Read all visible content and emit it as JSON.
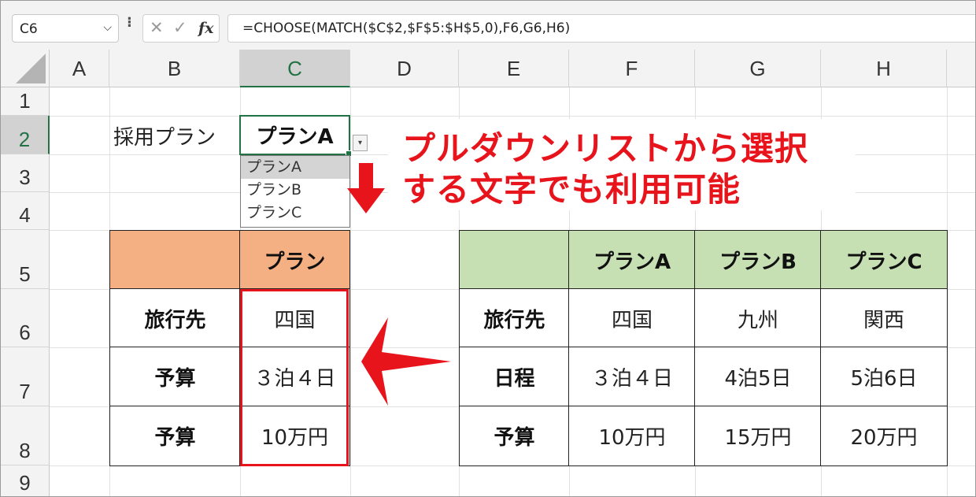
{
  "formula_bar": {
    "name_box": "C6",
    "cancel_glyph": "✕",
    "enter_glyph": "✓",
    "fx_label": "fx",
    "formula": "=CHOOSE(MATCH($C$2,$F$5:$H$5,0),F6,G6,H6)"
  },
  "columns": [
    "A",
    "B",
    "C",
    "D",
    "E",
    "F",
    "G",
    "H"
  ],
  "rows": [
    "1",
    "2",
    "3",
    "4",
    "5",
    "6",
    "7",
    "8",
    "9"
  ],
  "selected_column": "C",
  "selected_row": "2",
  "cells": {
    "B2": "採用プラン",
    "C2": "プランA"
  },
  "dropdown": {
    "options": [
      "プランA",
      "プランB",
      "プランC"
    ],
    "highlighted": "プランA"
  },
  "left_table": {
    "header": [
      "",
      "プラン"
    ],
    "rows": [
      [
        "旅行先",
        "四国"
      ],
      [
        "予算",
        "３泊４日"
      ],
      [
        "予算",
        "10万円"
      ]
    ]
  },
  "right_table": {
    "header": [
      "",
      "プランA",
      "プランB",
      "プランC"
    ],
    "rows": [
      [
        "旅行先",
        "四国",
        "九州",
        "関西"
      ],
      [
        "日程",
        "３泊４日",
        "4泊5日",
        "5泊6日"
      ],
      [
        "予算",
        "10万円",
        "15万円",
        "20万円"
      ]
    ]
  },
  "annotation": {
    "line1": "プルダウンリストから選択",
    "line2": "する文字でも利用可能"
  },
  "colors": {
    "accent": "#217346",
    "annotation_red": "#e8141c",
    "header_orange": "#f4b083",
    "header_green": "#c6e0b4"
  }
}
